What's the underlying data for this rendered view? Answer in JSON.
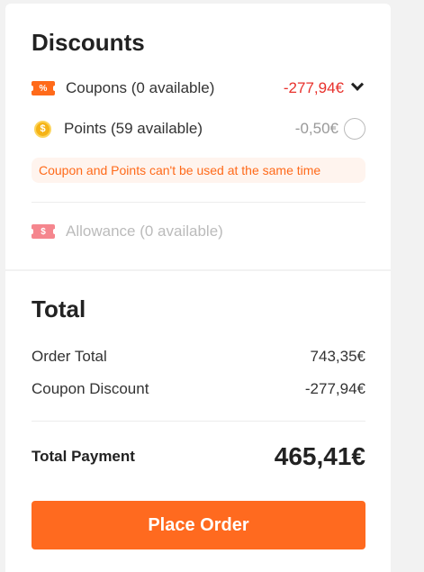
{
  "discounts": {
    "title": "Discounts",
    "coupons": {
      "icon": "coupon-icon",
      "label": "Coupons (0 available)",
      "amount": "-277,94€",
      "amount_color": "#e8312c"
    },
    "points": {
      "icon": "coin-icon",
      "coin_symbol": "$",
      "label": "Points (59 available)",
      "amount": "-0,50€",
      "selected": false
    },
    "notice": "Coupon and Points can't be used at the same time",
    "allowance": {
      "icon": "allowance-icon",
      "label": "Allowance (0 available)",
      "disabled": true
    }
  },
  "total": {
    "title": "Total",
    "order_total_label": "Order Total",
    "order_total_value": "743,35€",
    "coupon_discount_label": "Coupon Discount",
    "coupon_discount_value": "-277,94€",
    "payment_label": "Total Payment",
    "payment_value": "465,41€"
  },
  "place_order": {
    "label": "Place Order",
    "color": "#ff6a1f"
  }
}
